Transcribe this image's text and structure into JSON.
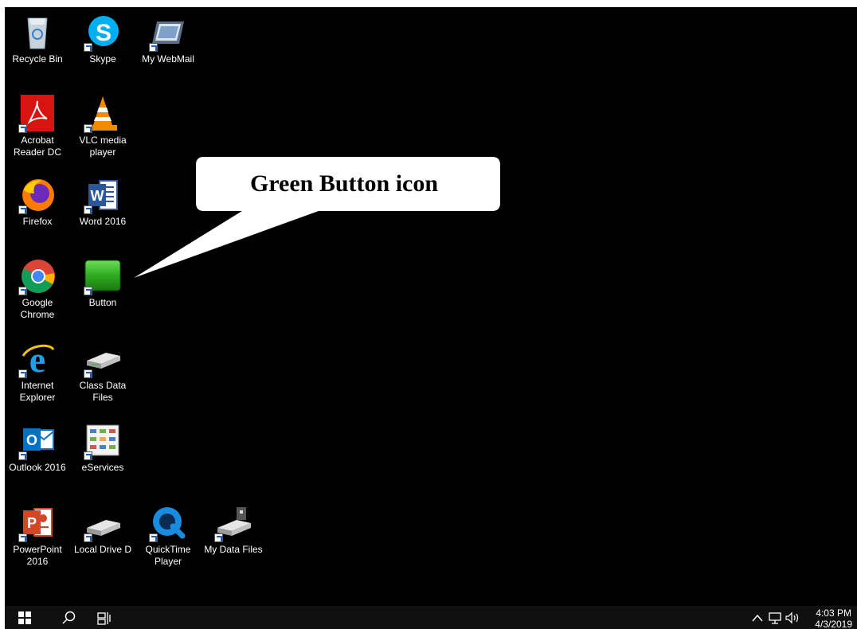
{
  "desktop": {
    "icons": [
      {
        "label": "Recycle Bin"
      },
      {
        "label": "Skype"
      },
      {
        "label": "My WebMail"
      },
      {
        "label": "Acrobat Reader DC"
      },
      {
        "label": "VLC media player"
      },
      {
        "label": "Firefox"
      },
      {
        "label": "Word 2016"
      },
      {
        "label": "Google Chrome"
      },
      {
        "label": "Button"
      },
      {
        "label": "Internet Explorer"
      },
      {
        "label": "Class Data Files"
      },
      {
        "label": "Outlook 2016"
      },
      {
        "label": "eServices"
      },
      {
        "label": "PowerPoint 2016"
      },
      {
        "label": "Local Drive D"
      },
      {
        "label": "QuickTime Player"
      },
      {
        "label": "My Data Files"
      }
    ]
  },
  "callout": {
    "text": "Green Button icon"
  },
  "taskbar": {
    "time": "4:03 PM",
    "date": "4/3/2019"
  },
  "colors": {
    "desktop_bg": "#000000",
    "taskbar_bg": "#101010",
    "button_green": "#2faa1f"
  }
}
